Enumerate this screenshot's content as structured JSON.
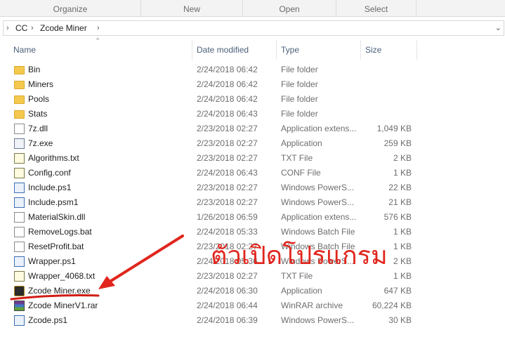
{
  "ribbon": {
    "groups": [
      "Organize",
      "New",
      "Open",
      "Select"
    ]
  },
  "address": {
    "segments": [
      "CC",
      "Zcode Miner"
    ]
  },
  "columns": {
    "name": "Name",
    "date": "Date modified",
    "type": "Type",
    "size": "Size"
  },
  "files": [
    {
      "name": "Bin",
      "date": "2/24/2018 06:42",
      "type": "File folder",
      "size": "",
      "icon": "folder-icon"
    },
    {
      "name": "Miners",
      "date": "2/24/2018 06:42",
      "type": "File folder",
      "size": "",
      "icon": "folder-icon"
    },
    {
      "name": "Pools",
      "date": "2/24/2018 06:42",
      "type": "File folder",
      "size": "",
      "icon": "folder-icon"
    },
    {
      "name": "Stats",
      "date": "2/24/2018 06:43",
      "type": "File folder",
      "size": "",
      "icon": "folder-icon"
    },
    {
      "name": "7z.dll",
      "date": "2/23/2018 02:27",
      "type": "Application extens...",
      "size": "1,049 KB",
      "icon": "dll-file-icon"
    },
    {
      "name": "7z.exe",
      "date": "2/23/2018 02:27",
      "type": "Application",
      "size": "259 KB",
      "icon": "exe-file-icon"
    },
    {
      "name": "Algorithms.txt",
      "date": "2/23/2018 02:27",
      "type": "TXT File",
      "size": "2 KB",
      "icon": "txt-file-icon"
    },
    {
      "name": "Config.conf",
      "date": "2/24/2018 06:43",
      "type": "CONF File",
      "size": "1 KB",
      "icon": "txt-file-icon"
    },
    {
      "name": "Include.ps1",
      "date": "2/23/2018 02:27",
      "type": "Windows PowerS...",
      "size": "22 KB",
      "icon": "powershell-file-icon"
    },
    {
      "name": "Include.psm1",
      "date": "2/23/2018 02:27",
      "type": "Windows PowerS...",
      "size": "21 KB",
      "icon": "powershell-file-icon"
    },
    {
      "name": "MaterialSkin.dll",
      "date": "1/26/2018 06:59",
      "type": "Application extens...",
      "size": "576 KB",
      "icon": "dll-file-icon"
    },
    {
      "name": "RemoveLogs.bat",
      "date": "2/24/2018 05:33",
      "type": "Windows Batch File",
      "size": "1 KB",
      "icon": "bat-file-icon"
    },
    {
      "name": "ResetProfit.bat",
      "date": "2/23/2018 02:27",
      "type": "Windows Batch File",
      "size": "1 KB",
      "icon": "bat-file-icon"
    },
    {
      "name": "Wrapper.ps1",
      "date": "2/24/2018 05:36",
      "type": "Windows PowerS...",
      "size": "2 KB",
      "icon": "powershell-file-icon"
    },
    {
      "name": "Wrapper_4068.txt",
      "date": "2/23/2018 02:27",
      "type": "TXT File",
      "size": "1 KB",
      "icon": "txt-file-icon"
    },
    {
      "name": "Zcode Miner.exe",
      "date": "2/24/2018 06:30",
      "type": "Application",
      "size": "647 KB",
      "icon": "zcode-app-icon"
    },
    {
      "name": "Zcode MinerV1.rar",
      "date": "2/24/2018 06:44",
      "type": "WinRAR archive",
      "size": "60,224 KB",
      "icon": "rar-archive-icon"
    },
    {
      "name": "Zcode.ps1",
      "date": "2/24/2018 06:39",
      "type": "Windows PowerS...",
      "size": "30 KB",
      "icon": "powershell-file-icon"
    }
  ],
  "annotation": {
    "text": "ตัวเปิดโปรแกรม",
    "color": "#e0261d"
  }
}
